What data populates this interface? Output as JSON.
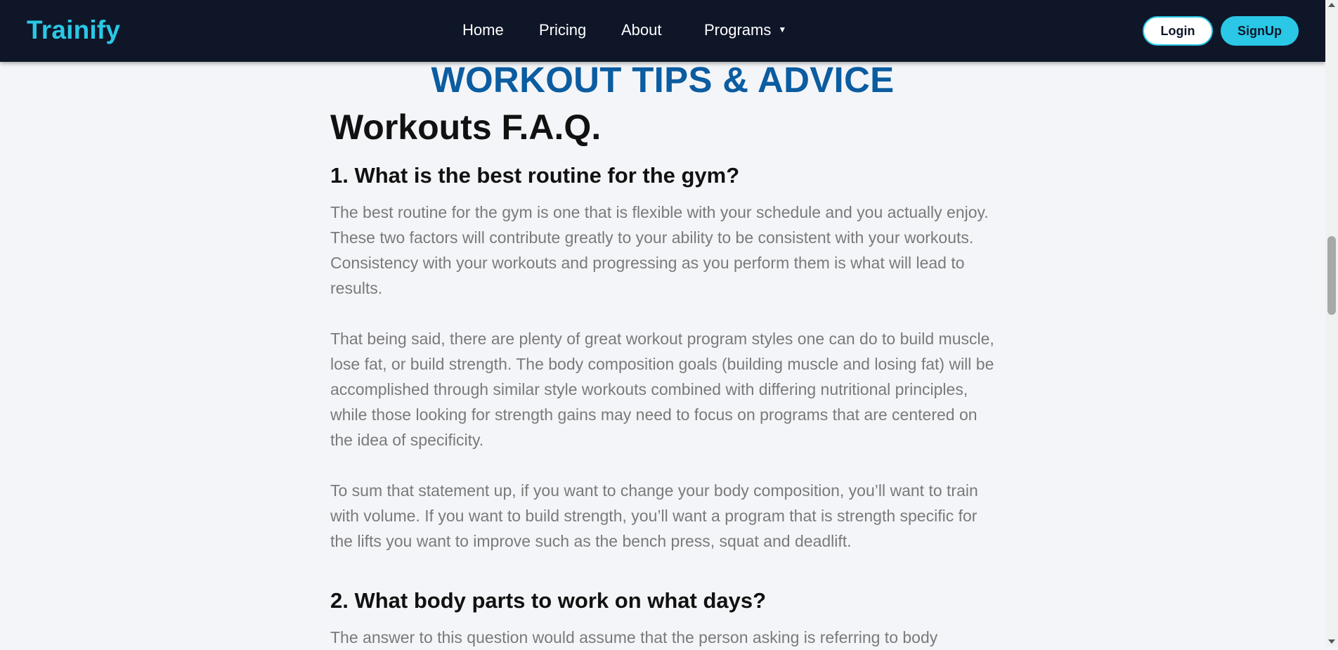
{
  "nav": {
    "brand": "Trainify",
    "links": {
      "home": "Home",
      "pricing": "Pricing",
      "about": "About",
      "programs": "Programs"
    },
    "login_label": "Login",
    "signup_label": "SignUp"
  },
  "page": {
    "heading": "WORKOUT TIPS & ADVICE",
    "faq_title": "Workouts F.A.Q.",
    "questions": [
      {
        "title": "1. What is the best routine for the gym?",
        "paragraphs": [
          "The best routine for the gym is one that is flexible with your schedule and you actually enjoy. These two factors will contribute greatly to your ability to be consistent with your workouts. Consistency with your workouts and progressing as you perform them is what will lead to results.",
          "That being said, there are plenty of great workout program styles one can do to build muscle, lose fat, or build strength. The body composition goals (building muscle and losing fat) will be accomplished through similar style workouts combined with differing nutritional principles, while those looking for strength gains may need to focus on programs that are centered on the idea of specificity.",
          "To sum that statement up, if you want to change your body composition, you’ll want to train with volume. If you want to build strength, you’ll want a program that is strength specific for the lifts you want to improve such as the bench press, squat and deadlift."
        ]
      },
      {
        "title": "2. What body parts to work on what days?",
        "paragraphs": [
          "The answer to this question would assume that the person asking is referring to body"
        ]
      }
    ]
  },
  "colors": {
    "navbar_bg": "#0e1628",
    "brand_accent": "#2ac8e6",
    "heading_blue": "#0b5ca0",
    "body_text": "#7a7a7a",
    "page_bg": "#f4f5f8"
  }
}
